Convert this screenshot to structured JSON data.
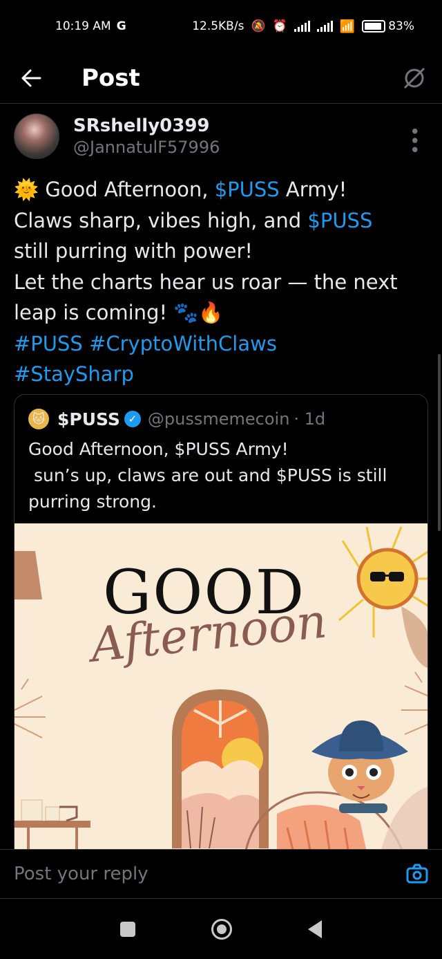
{
  "status_bar": {
    "time": "10:19 AM",
    "carrier_icon": "G",
    "net_speed": "12.5KB/s",
    "battery": "83%"
  },
  "topbar": {
    "title": "Post"
  },
  "post": {
    "display_name": "SRshelly0399",
    "handle": "@JannatulF57996",
    "lines": [
      [
        {
          "t": "🌞 Good Afternoon, "
        },
        {
          "t": "$PUSS",
          "link": true
        },
        {
          "t": " Army!"
        }
      ],
      [
        {
          "t": "Claws sharp, vibes high, and "
        },
        {
          "t": "$PUSS",
          "link": true
        }
      ],
      [
        {
          "t": "still purring with power!"
        }
      ],
      [
        {
          "t": "Let the charts hear us roar — the next"
        }
      ],
      [
        {
          "t": "leap is coming! 🐾🔥"
        }
      ],
      [
        {
          "t": "#PUSS",
          "link": true
        },
        {
          "t": " "
        },
        {
          "t": "#CryptoWithClaws",
          "link": true
        }
      ],
      [
        {
          "t": "#StaySharp",
          "link": true
        }
      ]
    ]
  },
  "quote": {
    "name": "$PUSS",
    "handle": "@pussmemecoin",
    "time": "· 1d",
    "lines": [
      "Good Afternoon, $PUSS Army!",
      " sun’s up, claws are out and $PUSS is still",
      "purring strong."
    ],
    "image": {
      "title": "GOOD",
      "subtitle": "Afternoon"
    }
  },
  "reply": {
    "placeholder": "Post your reply"
  },
  "colors": {
    "accent": "#1d9bf0",
    "background": "#000000",
    "muted": "#71767b",
    "text": "#e7e9ea"
  }
}
